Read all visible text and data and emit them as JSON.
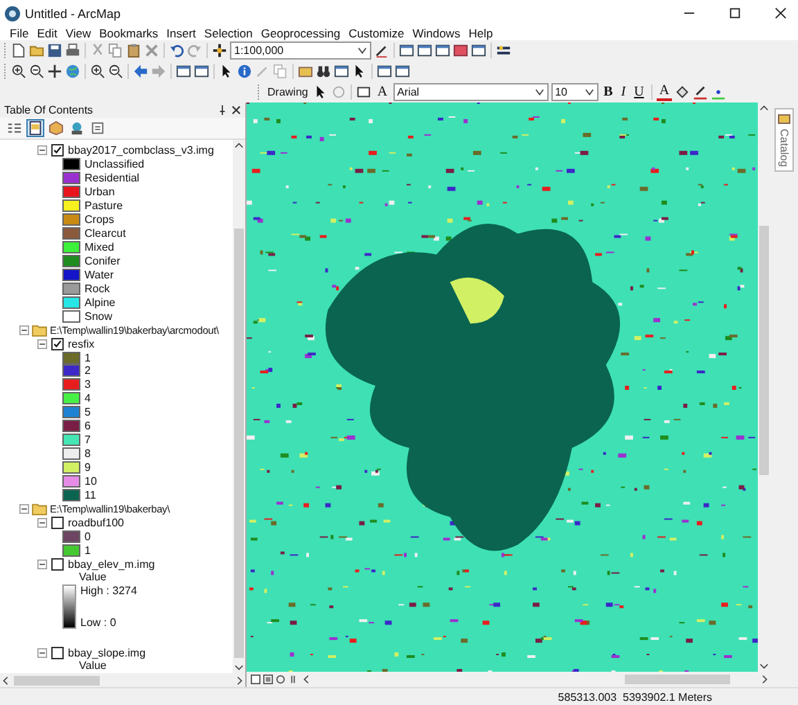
{
  "window": {
    "title": "Untitled - ArcMap"
  },
  "menu": [
    {
      "label": "File"
    },
    {
      "label": "Edit"
    },
    {
      "label": "View"
    },
    {
      "label": "Bookmarks"
    },
    {
      "label": "Insert"
    },
    {
      "label": "Selection"
    },
    {
      "label": "Geoprocessing"
    },
    {
      "label": "Customize"
    },
    {
      "label": "Windows"
    },
    {
      "label": "Help"
    }
  ],
  "toolbar": {
    "scale": "1:100,000"
  },
  "drawing_toolbar": {
    "label": "Drawing",
    "text_tool": "A",
    "font": "Arial",
    "font_size": "10",
    "bold": "B",
    "italic": "I",
    "underline": "U",
    "font_color": "A"
  },
  "toc": {
    "title": "Table Of Contents",
    "tree": [
      {
        "kind": "layer",
        "name": "bbay2017_combclass_v3.img",
        "checked": true,
        "expanded": true,
        "legend": [
          {
            "label": "Unclassified",
            "color": "#000000"
          },
          {
            "label": "Residential",
            "color": "#9b30d0"
          },
          {
            "label": "Urban",
            "color": "#e8141c"
          },
          {
            "label": "Pasture",
            "color": "#f5f01e"
          },
          {
            "label": "Crops",
            "color": "#c88a14"
          },
          {
            "label": "Clearcut",
            "color": "#8b5a3c"
          },
          {
            "label": "Mixed",
            "color": "#3cf03c"
          },
          {
            "label": "Conifer",
            "color": "#1e8c1e"
          },
          {
            "label": "Water",
            "color": "#1414c8"
          },
          {
            "label": "Rock",
            "color": "#9a9a9a"
          },
          {
            "label": "Alpine",
            "color": "#28e6e6"
          },
          {
            "label": "Snow",
            "color": "#ffffff"
          }
        ]
      },
      {
        "kind": "group",
        "name": "E:\\Temp\\wallin19\\bakerbay\\arcmodout\\",
        "expanded": true,
        "children": [
          {
            "kind": "layer",
            "name": "resfix",
            "checked": true,
            "expanded": true,
            "legend": [
              {
                "label": "1",
                "color": "#6b6b2a"
              },
              {
                "label": "2",
                "color": "#3c28c8"
              },
              {
                "label": "3",
                "color": "#e81e1e"
              },
              {
                "label": "4",
                "color": "#46f046"
              },
              {
                "label": "5",
                "color": "#1e82d2"
              },
              {
                "label": "6",
                "color": "#7a1e46"
              },
              {
                "label": "7",
                "color": "#46e6b4"
              },
              {
                "label": "8",
                "color": "#eeeeee"
              },
              {
                "label": "9",
                "color": "#d2f064"
              },
              {
                "label": "10",
                "color": "#e68ce6"
              },
              {
                "label": "11",
                "color": "#0a6450"
              }
            ]
          }
        ]
      },
      {
        "kind": "group",
        "name": "E:\\Temp\\wallin19\\bakerbay\\",
        "expanded": true,
        "children": [
          {
            "kind": "layer",
            "name": "roadbuf100",
            "checked": false,
            "expanded": true,
            "legend": [
              {
                "label": "0",
                "color": "#6e4664"
              },
              {
                "label": "1",
                "color": "#46c832"
              }
            ]
          },
          {
            "kind": "layer",
            "name": "bbay_elev_m.img",
            "checked": false,
            "expanded": true,
            "ramp": {
              "title": "Value",
              "high": "High : 3274",
              "low": "Low : 0"
            }
          },
          {
            "kind": "layer",
            "name": "bbay_slope.img",
            "checked": false,
            "expanded": true,
            "ramp": {
              "title": "Value"
            }
          }
        ]
      }
    ]
  },
  "catalog_tab": {
    "label": "Catalog"
  },
  "status_bar": {
    "coordinates": "585313.003  5393902.1 Meters"
  }
}
